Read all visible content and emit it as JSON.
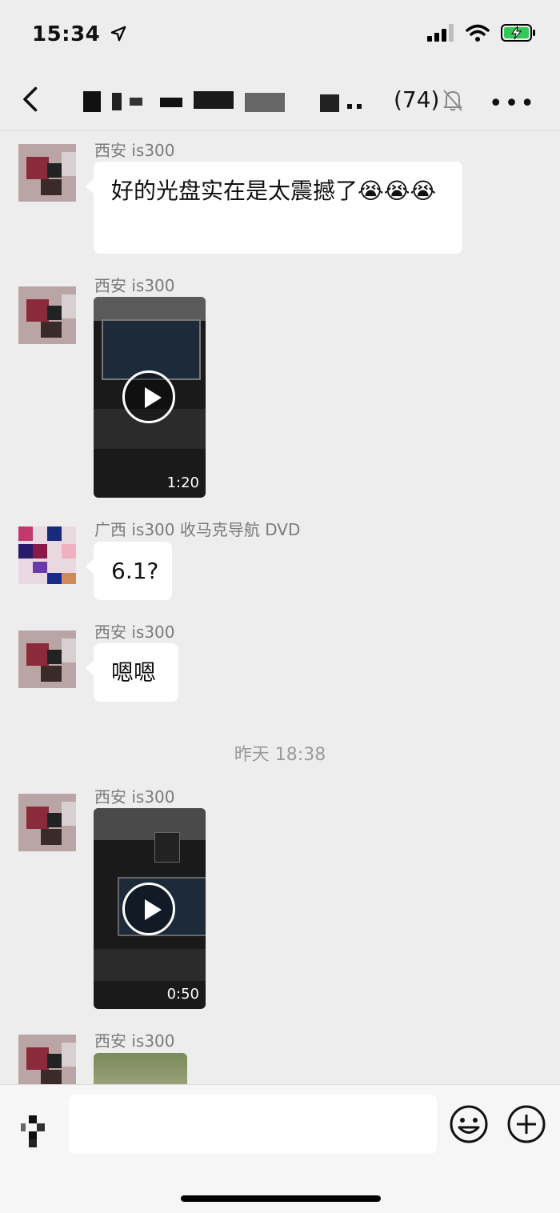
{
  "status_bar": {
    "time": "15:34",
    "icons": [
      "location-arrow-icon",
      "cellular-signal-icon",
      "wifi-icon",
      "battery-charging-icon"
    ]
  },
  "nav": {
    "group_title": "",
    "member_count": "(74)",
    "icons": [
      "back-chevron-icon",
      "mute-bell-icon",
      "more-icon"
    ]
  },
  "messages": [
    {
      "sender": "西安 is300",
      "type": "text",
      "text": "好的光盘实在是太震撼了😭😭😭"
    },
    {
      "sender": "西安 is300",
      "type": "video",
      "duration": "1:20"
    },
    {
      "sender": "广西 is300 收马克导航 DVD",
      "type": "text",
      "text": "6.1?"
    },
    {
      "sender": "西安 is300",
      "type": "text",
      "text": "嗯嗯"
    },
    {
      "sender": "西安 is300",
      "type": "video",
      "duration": "0:50"
    },
    {
      "sender": "西安 is300",
      "type": "image"
    }
  ],
  "timestamp": "昨天 18:38",
  "input_bar": {
    "placeholder": "",
    "icons": [
      "voice-icon",
      "emoji-icon",
      "add-icon"
    ]
  },
  "colors": {
    "background": "#ededed",
    "bubble": "#ffffff",
    "sender_text": "#7b7b7b",
    "timestamp_text": "#9a9a9a"
  }
}
